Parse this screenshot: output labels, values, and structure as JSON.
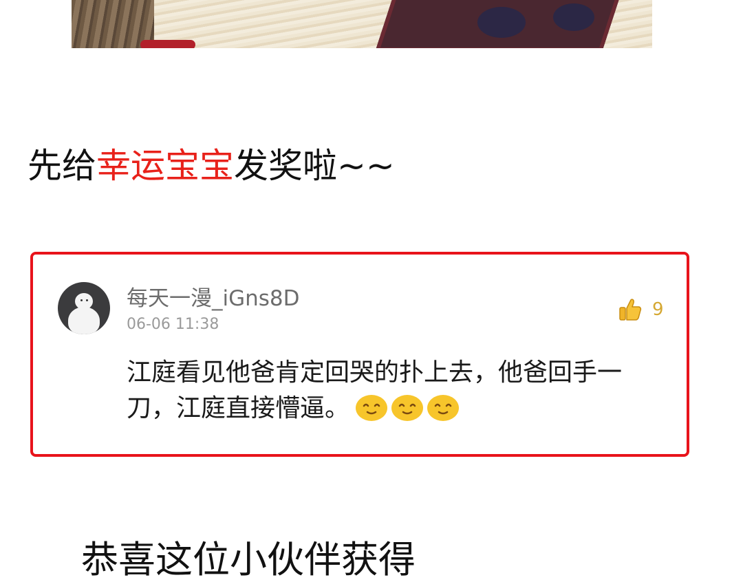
{
  "headline": {
    "prefix": "先给",
    "highlight": "幸运宝宝",
    "suffix": "发奖啦~~",
    "highlight_color": "#e8211a"
  },
  "comment": {
    "border_color": "#e8131b",
    "username": "每天一漫_iGns8D",
    "timestamp": "06-06 11:38",
    "likes": "9",
    "like_icon": "thumbs-up-icon",
    "text": "江庭看见他爸肯定回哭的扑上去，他爸回手一刀，江庭直接懵逼。",
    "emoji_icon": "smiling-face-icon",
    "emoji_count": 3
  },
  "congrats": "恭喜这位小伙伴获得"
}
